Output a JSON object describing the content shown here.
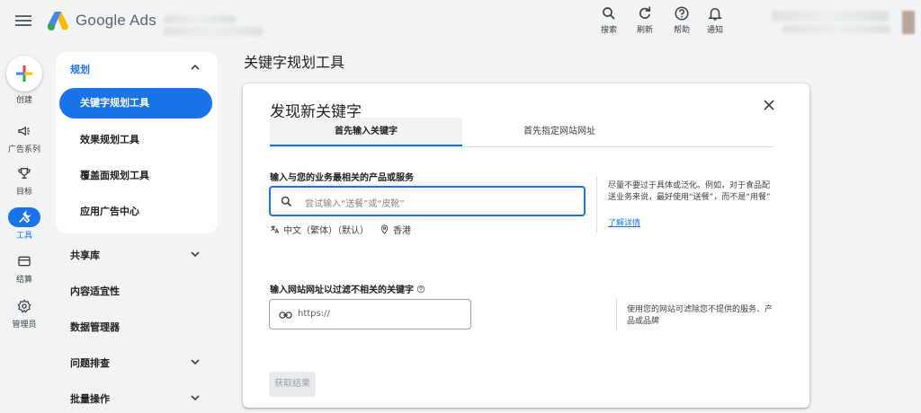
{
  "header": {
    "brand": "Google Ads",
    "tools": [
      {
        "icon": "search-icon",
        "label": "搜索"
      },
      {
        "icon": "refresh-icon",
        "label": "刷新"
      },
      {
        "icon": "help-icon",
        "label": "帮助"
      },
      {
        "icon": "bell-icon",
        "label": "通知"
      }
    ]
  },
  "rail": {
    "create_label": "创建",
    "items": [
      {
        "icon": "megaphone-icon",
        "label": "广告系列"
      },
      {
        "icon": "trophy-icon",
        "label": "目标"
      },
      {
        "icon": "tools-icon",
        "label": "工具"
      },
      {
        "icon": "credit-card-icon",
        "label": "结算"
      },
      {
        "icon": "gear-icon",
        "label": "管理员"
      }
    ]
  },
  "nav": {
    "section": "规划",
    "sub_items": [
      "关键字规划工具",
      "效果规划工具",
      "覆盖面规划工具",
      "应用广告中心"
    ],
    "main_items": [
      "共享库",
      "内容适宜性",
      "数据管理器",
      "问题排查",
      "批量操作"
    ]
  },
  "page": {
    "title": "关键字规划工具"
  },
  "card": {
    "title": "发现新关键字",
    "tabs": [
      "首先输入关键字",
      "首先指定网站网址"
    ],
    "products_label": "输入与您的业务最相关的产品或服务",
    "search_placeholder": "尝试输入“送餐”或“皮靴”",
    "language": "中文（繁体）（默认）",
    "location": "香港",
    "tip": "尽量不要过于具体或泛化。例如，对于食品配送业务来说，最好使用“送餐”，而不是“用餐”",
    "learn_more": "了解详情",
    "url_label": "输入网站网址以过滤不相关的关键字",
    "url_placeholder": "https://",
    "url_hint": "使用您的网站可滤除您不提供的服务、产品或品牌",
    "submit_label": "获取结果"
  },
  "colors": {
    "accent": "#1a73e8",
    "background": "#f1f3f4"
  }
}
